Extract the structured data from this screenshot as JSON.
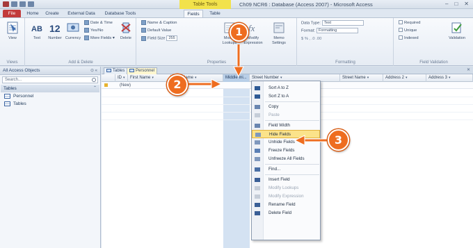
{
  "window": {
    "title": "Ch09 NCR6 : Database (Access 2007) - Microsoft Access",
    "contextual_tab": "Table Tools",
    "controls": [
      "–",
      "□",
      "✕"
    ]
  },
  "ribbon": {
    "tabs": [
      "File",
      "Home",
      "Create",
      "External Data",
      "Database Tools",
      "Fields",
      "Table"
    ],
    "help_label": "?",
    "groups": {
      "views": {
        "label": "Views",
        "view_label": "View"
      },
      "add_delete": {
        "label": "Add & Delete",
        "text_label": "Text",
        "number_label": "Number",
        "currency_label": "Currency",
        "date_time": "Date & Time",
        "yes_no": "Yes/No",
        "more_fields": "More Fields",
        "delete_label": "Delete"
      },
      "properties": {
        "label": "Properties",
        "name_caption": "Name & Caption",
        "default_value": "Default Value",
        "field_size_label": "Field Size",
        "field_size_value": "255",
        "modify_lookups": "Modify Lookups",
        "modify_expression": "Modify Expression",
        "memo_settings": "Memo Settings"
      },
      "formatting": {
        "label": "Formatting",
        "data_type_label": "Data Type:",
        "data_type_value": "Text",
        "format_label": "Format:",
        "format_value": "Formatting"
      },
      "validation": {
        "label": "Field Validation",
        "required": "Required",
        "unique": "Unique",
        "indexed": "Indexed",
        "validation_label": "Validation"
      }
    }
  },
  "nav_pane": {
    "header": "All Access Objects",
    "search_placeholder": "Search...",
    "group": "Tables",
    "items": [
      "Personnel",
      "Tables"
    ]
  },
  "document": {
    "tabs": [
      "Tables",
      "Personnel"
    ],
    "columns": [
      "ID",
      "First Name",
      "Last Name",
      "Middle Ini...",
      "Street Number",
      "Street Name",
      "Address 2",
      "Address 3"
    ],
    "new_record": "(New)"
  },
  "context_menu": {
    "items": [
      {
        "label": "Sort A to Z",
        "disabled": false
      },
      {
        "label": "Sort Z to A",
        "disabled": false
      },
      {
        "sep": true
      },
      {
        "label": "Copy",
        "disabled": false
      },
      {
        "label": "Paste",
        "disabled": true
      },
      {
        "sep": true
      },
      {
        "label": "Field Width",
        "disabled": false
      },
      {
        "label": "Hide Fields",
        "disabled": false,
        "highlighted": true
      },
      {
        "label": "Unhide Fields",
        "disabled": false
      },
      {
        "label": "Freeze Fields",
        "disabled": false
      },
      {
        "label": "Unfreeze All Fields",
        "disabled": false
      },
      {
        "sep": true
      },
      {
        "label": "Find...",
        "disabled": false
      },
      {
        "sep": true
      },
      {
        "label": "Insert Field",
        "disabled": false
      },
      {
        "label": "Modify Lookups",
        "disabled": true
      },
      {
        "label": "Modify Expression",
        "disabled": true
      },
      {
        "label": "Rename Field",
        "disabled": false
      },
      {
        "label": "Delete Field",
        "disabled": false
      }
    ]
  },
  "callouts": [
    "1",
    "2",
    "3"
  ],
  "colors": {
    "callout": "#ee6d20",
    "highlight": "#fbe38a",
    "contextual_tab": "#f2e24b"
  }
}
